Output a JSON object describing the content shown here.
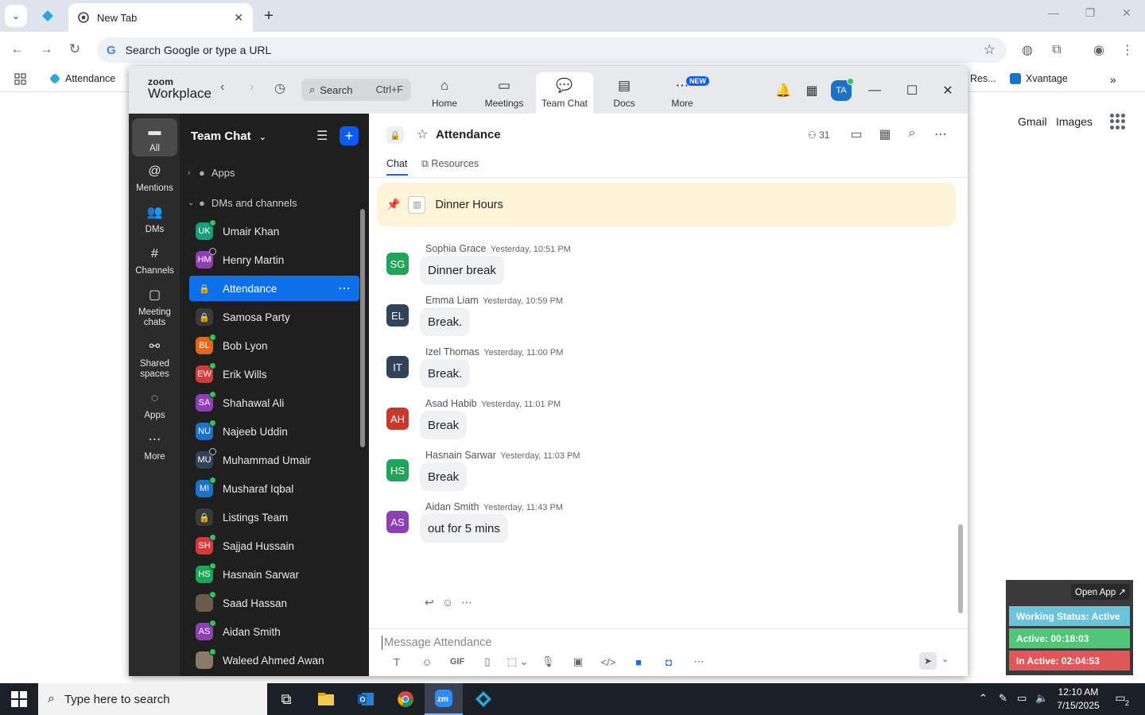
{
  "browser": {
    "tab_title": "New Tab",
    "omnibox_placeholder": "Search Google or type a URL",
    "bookmarks": [
      {
        "label": "Attendance"
      },
      {
        "label": "Res..."
      },
      {
        "label": "Xvantage"
      }
    ],
    "ntp_links": [
      "Gmail",
      "Images"
    ]
  },
  "zoom": {
    "logo_top": "zoom",
    "logo_bottom": "Workplace",
    "search_label": "Search",
    "search_shortcut": "Ctrl+F",
    "tabs": [
      {
        "label": "Home"
      },
      {
        "label": "Meetings"
      },
      {
        "label": "Team Chat"
      },
      {
        "label": "Docs"
      },
      {
        "label": "More"
      }
    ],
    "more_badge": "NEW",
    "avatar_initials": "TA",
    "rail": [
      {
        "label": "All"
      },
      {
        "label": "Mentions"
      },
      {
        "label": "DMs"
      },
      {
        "label": "Channels"
      },
      {
        "label": "Meeting chats"
      },
      {
        "label": "Shared spaces"
      },
      {
        "label": "Apps"
      },
      {
        "label": "More"
      }
    ],
    "sidebar": {
      "title": "Team Chat",
      "groups": {
        "apps": "Apps",
        "dms": "DMs and channels"
      },
      "items": [
        {
          "initials": "UK",
          "name": "Umair Khan",
          "color": "#1a9d7b"
        },
        {
          "initials": "HM",
          "name": "Henry Martin",
          "color": "#8e3fb5"
        },
        {
          "initials": "",
          "name": "Attendance",
          "color": ""
        },
        {
          "initials": "",
          "name": "Samosa Party",
          "color": ""
        },
        {
          "initials": "BL",
          "name": "Bob Lyon",
          "color": "#e0681c"
        },
        {
          "initials": "EW",
          "name": "Erik Wills",
          "color": "#d33b3b"
        },
        {
          "initials": "SA",
          "name": "Shahawal Ali",
          "color": "#8e3fb5"
        },
        {
          "initials": "NU",
          "name": "Najeeb Uddin",
          "color": "#1a73c9"
        },
        {
          "initials": "MU",
          "name": "Muhammad Umair",
          "color": "#30435a"
        },
        {
          "initials": "MI",
          "name": "Musharaf Iqbal",
          "color": "#1a73c9"
        },
        {
          "initials": "",
          "name": "Listings Team",
          "color": ""
        },
        {
          "initials": "SH",
          "name": "Sajjad Hussain",
          "color": "#d33b3b"
        },
        {
          "initials": "HS",
          "name": "Hasnain Sarwar",
          "color": "#1fa55a"
        },
        {
          "initials": "",
          "name": "Saad Hassan",
          "color": "#6b5b4b"
        },
        {
          "initials": "AS",
          "name": "Aidan Smith",
          "color": "#8e3fb5"
        },
        {
          "initials": "",
          "name": "Waleed Ahmed Awan",
          "color": "#8a7a6a"
        }
      ]
    },
    "channel": {
      "name": "Attendance",
      "members": "31",
      "tabs": [
        "Chat",
        "Resources"
      ],
      "pinned": "Dinner Hours",
      "messages": [
        {
          "initials": "SG",
          "sender": "Sophia Grace",
          "time": "Yesterday, 10:51 PM",
          "text": "Dinner break",
          "color": "#1fa55a"
        },
        {
          "initials": "EL",
          "sender": "Emma Liam",
          "time": "Yesterday, 10:59 PM",
          "text": "Break.",
          "color": "#30435a"
        },
        {
          "initials": "IT",
          "sender": "Izel Thomas",
          "time": "Yesterday, 11:00 PM",
          "text": "Break.",
          "color": "#30435a"
        },
        {
          "initials": "AH",
          "sender": "Asad Habib",
          "time": "Yesterday, 11:01 PM",
          "text": "Break",
          "color": "#c63a2b"
        },
        {
          "initials": "HS",
          "sender": "Hasnain Sarwar",
          "time": "Yesterday, 11:03 PM",
          "text": "Break",
          "color": "#1fa55a"
        },
        {
          "initials": "AS",
          "sender": "Aidan Smith",
          "time": "Yesterday, 11:43 PM",
          "text": "out for 5 mins",
          "color": "#8e3fb5"
        }
      ],
      "composer_placeholder": "Message Attendance"
    }
  },
  "widget": {
    "open_app": "Open App ↗",
    "working_status": "Working Status: Active",
    "active": "Active: 00:18:03",
    "inactive": "In Active: 02:04:53"
  },
  "taskbar": {
    "search_placeholder": "Type here to search",
    "time": "12:10 AM",
    "date": "7/15/2025",
    "notif_count": "2"
  }
}
